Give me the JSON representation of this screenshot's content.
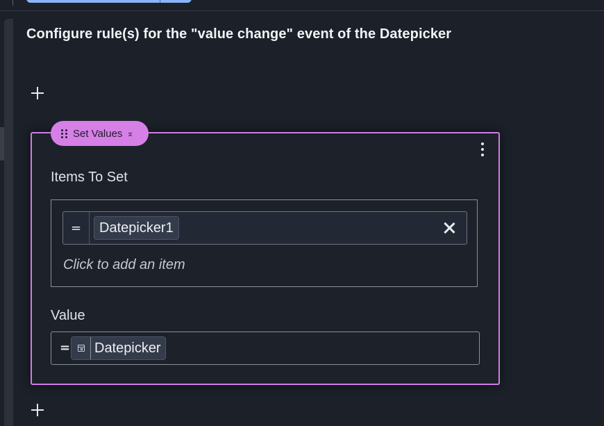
{
  "header": {
    "title": "Configure rule(s) for the \"value change\" event of the Datepicker"
  },
  "rule": {
    "action_label": "Set Values",
    "items_label": "Items To Set",
    "items": [
      {
        "operator": "=",
        "name": "Datepicker1"
      }
    ],
    "add_item_label": "Click to add an item",
    "value_label": "Value",
    "value_operator": "=",
    "value_chip": "Datepicker"
  },
  "icons": [
    "add-icon",
    "drag-handle-icon",
    "collapse-icon",
    "kebab-menu-icon",
    "close-icon",
    "calendar-icon"
  ],
  "colors": {
    "background": "#1b2029",
    "rule_accent": "#d67fe6",
    "chip_bg": "#343c4b",
    "top_button": "#8ab4f8"
  }
}
